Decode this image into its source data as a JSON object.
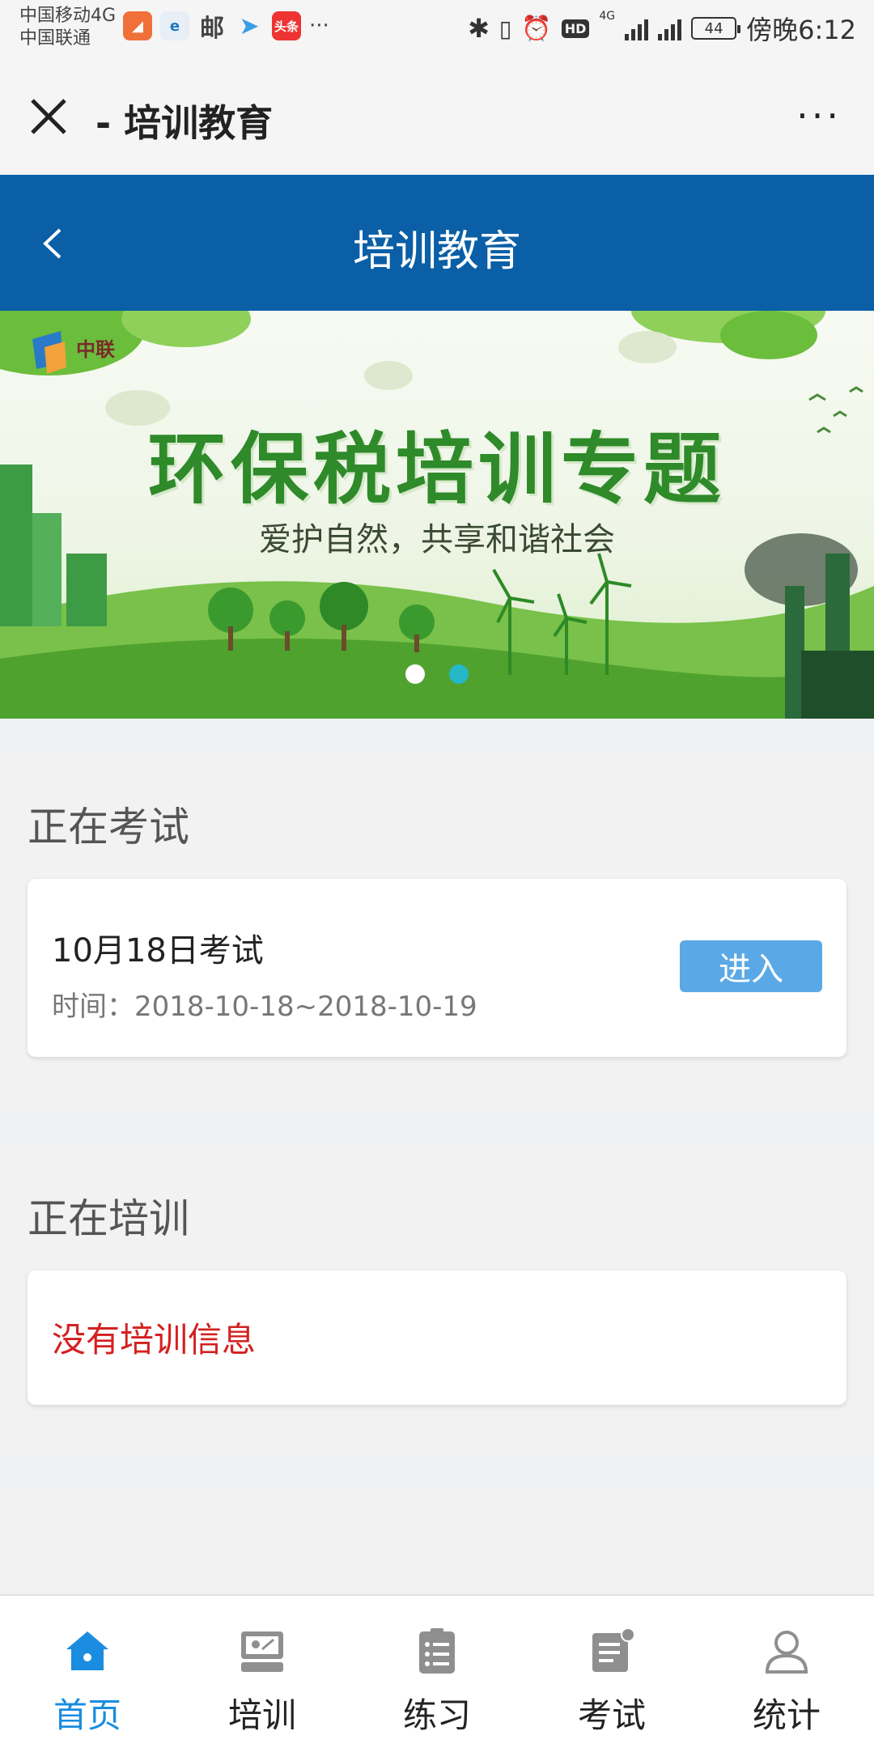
{
  "status_bar": {
    "carrier_1": "中国移动4G",
    "carrier_2": "中国联通",
    "app_toutiao": "头条",
    "app_mail": "邮",
    "more": "···",
    "hd": "HD",
    "net": "4G",
    "battery": "44",
    "time": "傍晚6:12"
  },
  "wechat_bar": {
    "title": "- 培训教育",
    "more": "···"
  },
  "header": {
    "title": "培训教育"
  },
  "banner": {
    "logo_text": "中联",
    "title": "环保税培训专题",
    "subtitle": "爱护自然，共享和谐社会",
    "slide_count": 2,
    "active_slide": 2
  },
  "exam_section": {
    "title": "正在考试",
    "exam_name": "10月18日考试",
    "exam_time": "时间：2018-10-18~2018-10-19",
    "enter_label": "进入"
  },
  "training_section": {
    "title": "正在培训",
    "empty_text": "没有培训信息"
  },
  "bottom_nav": {
    "items": [
      {
        "label": "首页",
        "icon": "home-icon",
        "active": true
      },
      {
        "label": "培训",
        "icon": "training-icon",
        "active": false
      },
      {
        "label": "练习",
        "icon": "practice-icon",
        "active": false
      },
      {
        "label": "考试",
        "icon": "exam-icon",
        "active": false
      },
      {
        "label": "统计",
        "icon": "statistics-icon",
        "active": false
      }
    ]
  },
  "colors": {
    "header_blue": "#0a5fa6",
    "button_blue": "#5aa9e6",
    "active_nav": "#1a8de0",
    "empty_red": "#d42020"
  }
}
